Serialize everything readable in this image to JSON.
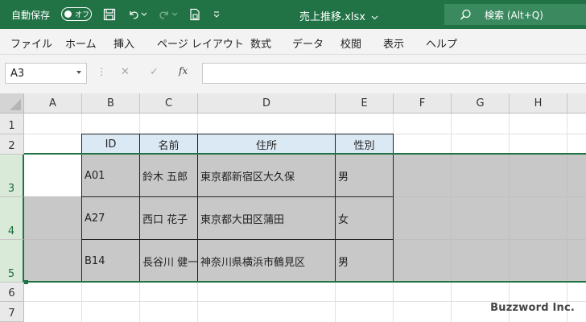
{
  "titlebar": {
    "autosave_label": "自動保存",
    "autosave_toggle": "オフ",
    "filename": "売上推移.xlsx",
    "search_placeholder": "検索 (Alt+Q)",
    "icons": [
      "save-icon",
      "undo-icon",
      "redo-icon",
      "form-icon",
      "customize-icon",
      "search-icon"
    ]
  },
  "menu": {
    "items": [
      "ファイル",
      "ホーム",
      "挿入",
      "ページ レイアウト",
      "数式",
      "データ",
      "校閲",
      "表示",
      "ヘルプ"
    ]
  },
  "formula_bar": {
    "name_box": "A3",
    "cancel_symbol": "✕",
    "enter_symbol": "✓",
    "fx_label": "fx",
    "formula": ""
  },
  "grid": {
    "columns": [
      "A",
      "B",
      "C",
      "D",
      "E",
      "F",
      "G",
      "H"
    ],
    "rows": [
      "1",
      "2",
      "3",
      "4",
      "5",
      "6",
      "7"
    ],
    "selected_rows": [
      "3",
      "4",
      "5"
    ],
    "active_cell": "A3"
  },
  "table": {
    "headers": [
      "ID",
      "名前",
      "住所",
      "性別"
    ],
    "rows": [
      [
        "A01",
        "鈴木 五郎",
        "東京都新宿区大久保",
        "男"
      ],
      [
        "A27",
        "西口 花子",
        "東京都大田区蒲田",
        "女"
      ],
      [
        "B14",
        "長谷川 健一",
        "神奈川県横浜市鶴見区",
        "男"
      ]
    ]
  },
  "watermark": "Buzzword Inc.",
  "colors": {
    "accent": "#217346",
    "header_fill": "#dbe9f5",
    "selection_fill": "#c8c8c8"
  }
}
